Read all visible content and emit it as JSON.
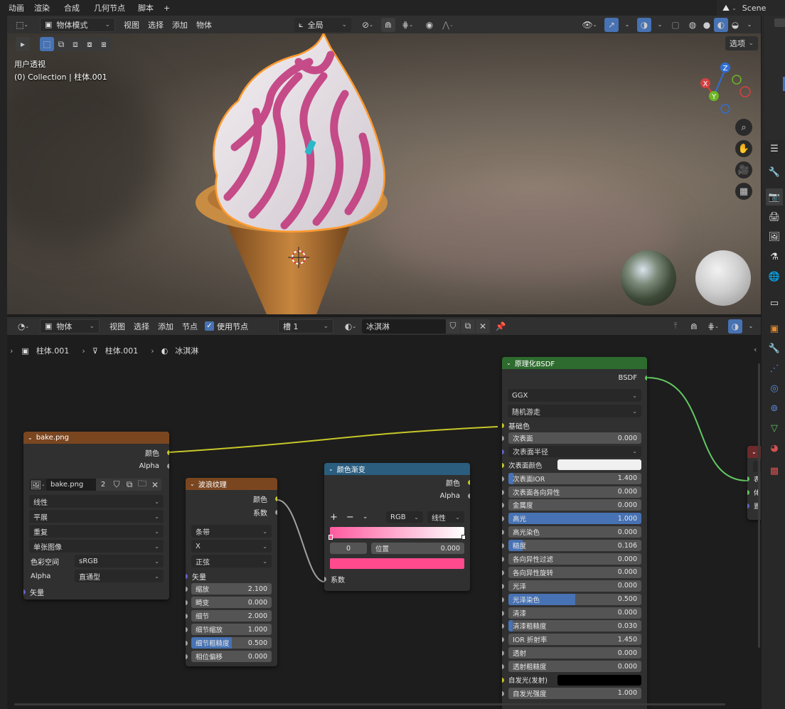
{
  "top_tabs": [
    "动画",
    "渲染",
    "合成",
    "几何节点",
    "脚本",
    "+"
  ],
  "scene_name": "Scene",
  "viewport": {
    "mode": "物体模式",
    "menus": [
      "视图",
      "选择",
      "添加",
      "物体"
    ],
    "transform_orientation": "全局",
    "options_label": "选项",
    "overlay_title": "用户透视",
    "overlay_subtitle": "(0) Collection | 柱体.001",
    "gizmo_labels": {
      "z": "Z",
      "x": "X",
      "y": "Y"
    }
  },
  "node_editor": {
    "object_type": "物体",
    "menus": [
      "视图",
      "选择",
      "添加",
      "节点"
    ],
    "use_nodes_label": "使用节点",
    "slot": "槽 1",
    "material": "冰淇淋",
    "breadcrumb": [
      "柱体.001",
      "柱体.001",
      "冰淇淋"
    ]
  },
  "nodes": {
    "image": {
      "title": "bake.png",
      "outputs": [
        "颜色",
        "Alpha"
      ],
      "image_name": "bake.png",
      "users": "2",
      "selects": [
        "线性",
        "平展",
        "重复",
        "单张图像"
      ],
      "color_space_label": "色彩空间",
      "color_space": "sRGB",
      "alpha_label": "Alpha",
      "alpha_mode": "直通型",
      "input": "矢量"
    },
    "wave": {
      "title": "波浪纹理",
      "outputs": [
        "颜色",
        "系数"
      ],
      "selects": [
        "条带",
        "X",
        "正弦"
      ],
      "vector": "矢量",
      "fields": [
        {
          "label": "缩放",
          "value": "2.100",
          "fill": 0
        },
        {
          "label": "畸变",
          "value": "0.000",
          "fill": 0
        },
        {
          "label": "细节",
          "value": "2.000",
          "fill": 0
        },
        {
          "label": "细节缩放",
          "value": "1.000",
          "fill": 0
        },
        {
          "label": "细节粗糙度",
          "value": "0.500",
          "fill": 0.5
        },
        {
          "label": "相位偏移",
          "value": "0.000",
          "fill": 0
        }
      ]
    },
    "ramp": {
      "title": "颜色渐变",
      "outputs": [
        "颜色",
        "Alpha"
      ],
      "color_mode": "RGB",
      "interpolation": "线性",
      "stop_index": "0",
      "position_label": "位置",
      "position_value": "0.000",
      "input": "系数",
      "ramp_start": "#ff5aa0",
      "ramp_end": "#ffffff",
      "stop_color": "#ff4a8e"
    },
    "bsdf": {
      "title": "原理化BSDF",
      "output": "BSDF",
      "distribution": "GGX",
      "subsurface_method": "随机游走",
      "base_color": "基础色",
      "fields": [
        {
          "type": "field",
          "label": "次表面",
          "value": "0.000",
          "fill": 0,
          "sock": "gy"
        },
        {
          "type": "select",
          "label": "次表面半径",
          "sock": "pu"
        },
        {
          "type": "color",
          "label": "次表面颜色",
          "color": "#f0f0f0",
          "sock": "yl"
        },
        {
          "type": "field",
          "label": "次表面IOR",
          "value": "1.400",
          "fill": 0.04,
          "sock": "gy"
        },
        {
          "type": "field",
          "label": "次表面各向异性",
          "value": "0.000",
          "fill": 0,
          "sock": "gy"
        },
        {
          "type": "field",
          "label": "金属度",
          "value": "0.000",
          "fill": 0,
          "sock": "gy"
        },
        {
          "type": "field",
          "label": "高光",
          "value": "1.000",
          "fill": 1,
          "sock": "gy"
        },
        {
          "type": "field",
          "label": "高光染色",
          "value": "0.000",
          "fill": 0,
          "sock": "gy"
        },
        {
          "type": "field",
          "label": "糙度",
          "value": "0.106",
          "fill": 0.106,
          "sock": "gy"
        },
        {
          "type": "field",
          "label": "各向异性过滤",
          "value": "0.000",
          "fill": 0,
          "sock": "gy"
        },
        {
          "type": "field",
          "label": "各向异性旋转",
          "value": "0.000",
          "fill": 0,
          "sock": "gy"
        },
        {
          "type": "field",
          "label": "光泽",
          "value": "0.000",
          "fill": 0,
          "sock": "gy"
        },
        {
          "type": "field",
          "label": "光泽染色",
          "value": "0.500",
          "fill": 0.5,
          "sock": "gy"
        },
        {
          "type": "field",
          "label": "清漆",
          "value": "0.000",
          "fill": 0,
          "sock": "gy"
        },
        {
          "type": "field",
          "label": "清漆粗糙度",
          "value": "0.030",
          "fill": 0.03,
          "sock": "gy"
        },
        {
          "type": "field",
          "label": "IOR 折射率",
          "value": "1.450",
          "fill": 0,
          "sock": "gy"
        },
        {
          "type": "field",
          "label": "透射",
          "value": "0.000",
          "fill": 0,
          "sock": "gy"
        },
        {
          "type": "field",
          "label": "透射粗糙度",
          "value": "0.000",
          "fill": 0,
          "sock": "gy"
        },
        {
          "type": "color",
          "label": "自发光(发射)",
          "color": "#000000",
          "sock": "yl"
        },
        {
          "type": "field",
          "label": "自发光强度",
          "value": "1.000",
          "fill": 0,
          "sock": "gy"
        }
      ]
    },
    "output_partial": {
      "labels": [
        "表",
        "体",
        "置"
      ]
    }
  },
  "colors": {
    "accent": "#4772b3",
    "link_yellow": "#c7c729",
    "link_gray": "#a1a1a1",
    "link_green": "#63c763",
    "header_image": "#7a4620",
    "header_texture": "#7a4620",
    "header_converter": "#2a5d7e",
    "header_shader": "#2e6b2e",
    "header_output": "#6e2a2a"
  },
  "icons": [
    "magnify-icon",
    "hand-icon",
    "camera-icon",
    "grid-icon",
    "pin-icon",
    "shield-icon",
    "copy-icon",
    "folder-icon",
    "close-icon"
  ]
}
